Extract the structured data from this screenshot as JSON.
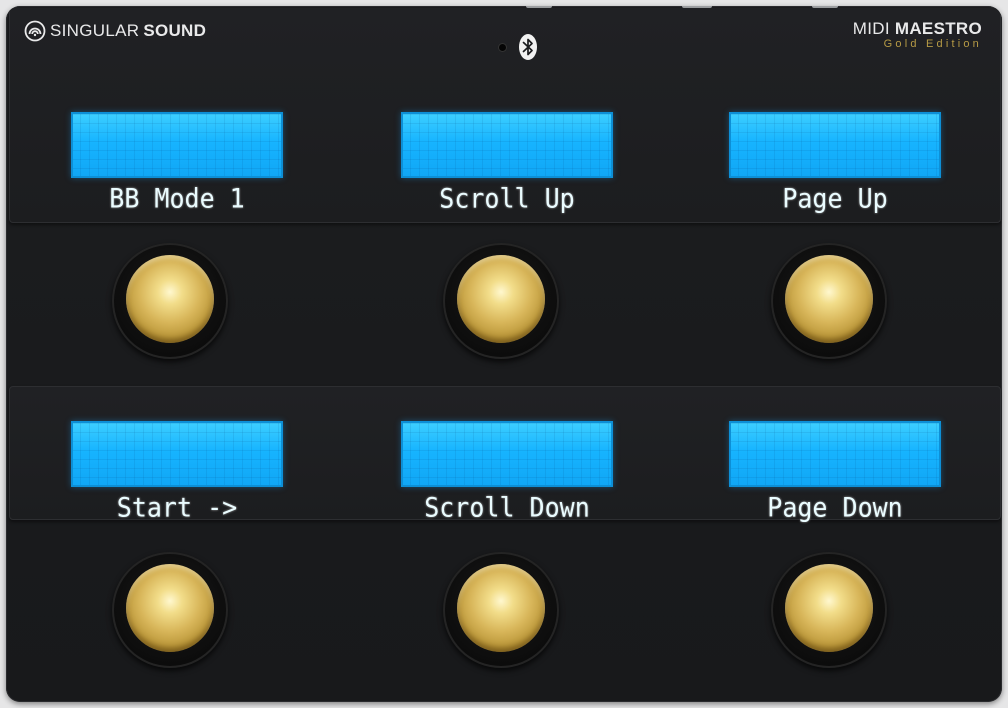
{
  "brand": {
    "thin": "SINGULAR",
    "bold": "SOUND"
  },
  "product": {
    "thin": "MIDI",
    "bold": "MAESTRO",
    "edition": "Gold Edition"
  },
  "icons": {
    "brand_mark": "singular-sound-logo-icon",
    "bluetooth": "bluetooth-icon"
  },
  "colors": {
    "lcd_background": "#17b4ff",
    "lcd_text": "#eafcff",
    "footswitch_gold": "#d8b65a",
    "edition_gold": "#b69a45",
    "device_body": "#1c1d1f"
  },
  "displays": {
    "top": [
      {
        "label": "BB Mode 1"
      },
      {
        "label": "Scroll Up"
      },
      {
        "label": "Page Up"
      }
    ],
    "bottom": [
      {
        "label": "Start ->"
      },
      {
        "label": "Scroll Down"
      },
      {
        "label": "Page Down"
      }
    ]
  }
}
